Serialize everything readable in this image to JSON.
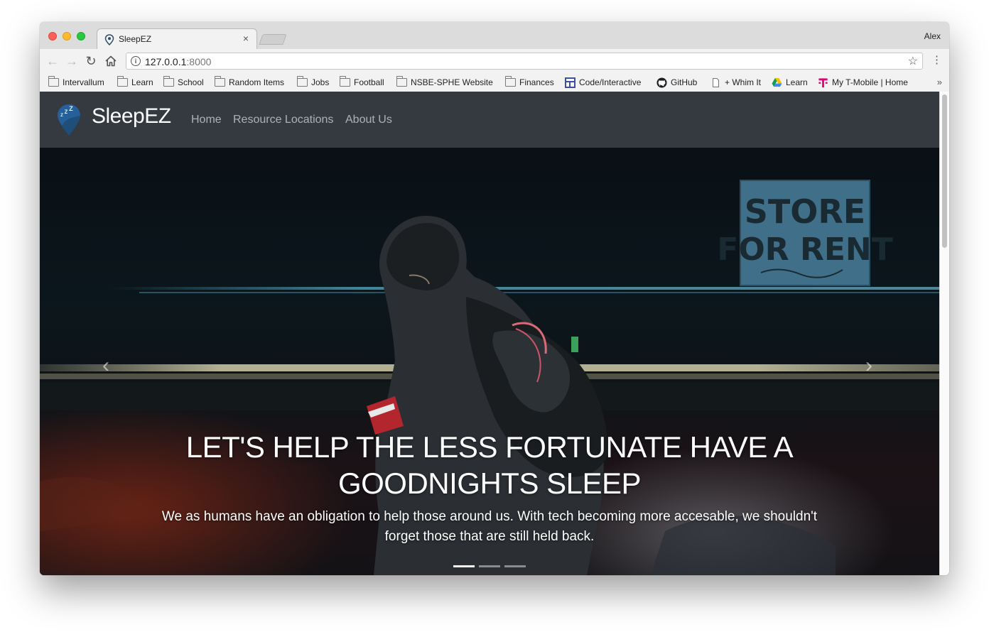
{
  "browser": {
    "tab_title": "SleepEZ",
    "tab_close": "×",
    "profile_name": "Alex",
    "url_host": "127.0.0.1",
    "url_port": ":8000",
    "bookmarks": [
      {
        "label": "Intervallum",
        "icon": "folder-icon"
      },
      {
        "label": "Learn",
        "icon": "folder-icon"
      },
      {
        "label": "School",
        "icon": "folder-icon"
      },
      {
        "label": "Random Items",
        "icon": "folder-icon"
      },
      {
        "label": "Jobs",
        "icon": "folder-icon"
      },
      {
        "label": "Football",
        "icon": "folder-icon"
      },
      {
        "label": "NSBE-SPHE Website",
        "icon": "folder-icon"
      },
      {
        "label": "Finances",
        "icon": "folder-icon"
      },
      {
        "label": "Code/Interactive",
        "icon": "code-interactive-icon"
      },
      {
        "label": "GitHub",
        "icon": "github-icon"
      },
      {
        "label": "+ Whim It",
        "icon": "page-icon"
      },
      {
        "label": "Learn",
        "icon": "google-drive-icon"
      },
      {
        "label": "My T-Mobile | Home",
        "icon": "t-mobile-icon"
      }
    ],
    "overflow_label": "»"
  },
  "site": {
    "brand": "SleepEZ",
    "nav": [
      "Home",
      "Resource Locations",
      "About Us"
    ],
    "hero": {
      "title": "LET'S HELP THE LESS FORTUNATE HAVE A GOODNIGHTS SLEEP",
      "text": "We as humans have an obligation to help those around us. With tech becoming more accesable, we shouldn't forget those that are still held back.",
      "sign_text_line1": "STORE",
      "sign_text_line2": "FOR RENT",
      "prev_arrow": "‹",
      "next_arrow": "›",
      "slide_count": 3,
      "active_slide": 1
    }
  },
  "colors": {
    "navbar_bg": "#343a40",
    "brand_pin": "#1f4e79",
    "tmobile": "#e20074"
  }
}
